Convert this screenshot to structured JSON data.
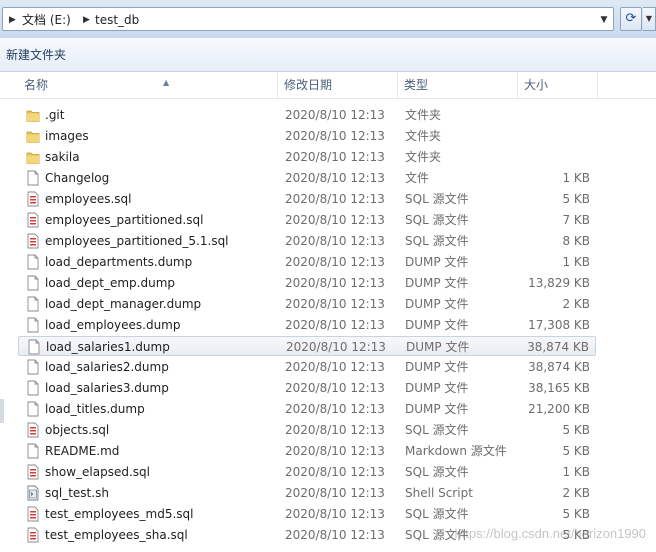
{
  "address": {
    "crumbs": [
      "文档 (E:)",
      "test_db"
    ]
  },
  "toolbar": {
    "new_folder": "新建文件夹"
  },
  "columns": {
    "name": "名称",
    "date": "修改日期",
    "type": "类型",
    "size": "大小"
  },
  "files": [
    {
      "name": ".git",
      "date": "2020/8/10 12:13",
      "type": "文件夹",
      "size": "",
      "icon": "folder"
    },
    {
      "name": "images",
      "date": "2020/8/10 12:13",
      "type": "文件夹",
      "size": "",
      "icon": "folder"
    },
    {
      "name": "sakila",
      "date": "2020/8/10 12:13",
      "type": "文件夹",
      "size": "",
      "icon": "folder"
    },
    {
      "name": "Changelog",
      "date": "2020/8/10 12:13",
      "type": "文件",
      "size": "1 KB",
      "icon": "file"
    },
    {
      "name": "employees.sql",
      "date": "2020/8/10 12:13",
      "type": "SQL 源文件",
      "size": "5 KB",
      "icon": "sql"
    },
    {
      "name": "employees_partitioned.sql",
      "date": "2020/8/10 12:13",
      "type": "SQL 源文件",
      "size": "7 KB",
      "icon": "sql"
    },
    {
      "name": "employees_partitioned_5.1.sql",
      "date": "2020/8/10 12:13",
      "type": "SQL 源文件",
      "size": "8 KB",
      "icon": "sql"
    },
    {
      "name": "load_departments.dump",
      "date": "2020/8/10 12:13",
      "type": "DUMP 文件",
      "size": "1 KB",
      "icon": "file"
    },
    {
      "name": "load_dept_emp.dump",
      "date": "2020/8/10 12:13",
      "type": "DUMP 文件",
      "size": "13,829 KB",
      "icon": "file"
    },
    {
      "name": "load_dept_manager.dump",
      "date": "2020/8/10 12:13",
      "type": "DUMP 文件",
      "size": "2 KB",
      "icon": "file"
    },
    {
      "name": "load_employees.dump",
      "date": "2020/8/10 12:13",
      "type": "DUMP 文件",
      "size": "17,308 KB",
      "icon": "file"
    },
    {
      "name": "load_salaries1.dump",
      "date": "2020/8/10 12:13",
      "type": "DUMP 文件",
      "size": "38,874 KB",
      "icon": "file",
      "selected": true
    },
    {
      "name": "load_salaries2.dump",
      "date": "2020/8/10 12:13",
      "type": "DUMP 文件",
      "size": "38,874 KB",
      "icon": "file"
    },
    {
      "name": "load_salaries3.dump",
      "date": "2020/8/10 12:13",
      "type": "DUMP 文件",
      "size": "38,165 KB",
      "icon": "file"
    },
    {
      "name": "load_titles.dump",
      "date": "2020/8/10 12:13",
      "type": "DUMP 文件",
      "size": "21,200 KB",
      "icon": "file"
    },
    {
      "name": "objects.sql",
      "date": "2020/8/10 12:13",
      "type": "SQL 源文件",
      "size": "5 KB",
      "icon": "sql"
    },
    {
      "name": "README.md",
      "date": "2020/8/10 12:13",
      "type": "Markdown 源文件",
      "size": "5 KB",
      "icon": "file"
    },
    {
      "name": "show_elapsed.sql",
      "date": "2020/8/10 12:13",
      "type": "SQL 源文件",
      "size": "1 KB",
      "icon": "sql"
    },
    {
      "name": "sql_test.sh",
      "date": "2020/8/10 12:13",
      "type": "Shell Script",
      "size": "2 KB",
      "icon": "shell"
    },
    {
      "name": "test_employees_md5.sql",
      "date": "2020/8/10 12:13",
      "type": "SQL 源文件",
      "size": "5 KB",
      "icon": "sql"
    },
    {
      "name": "test_employees_sha.sql",
      "date": "2020/8/10 12:13",
      "type": "SQL 源文件",
      "size": "5 KB",
      "icon": "sql"
    }
  ],
  "watermark": "https://blog.csdn.net/horizon1990"
}
